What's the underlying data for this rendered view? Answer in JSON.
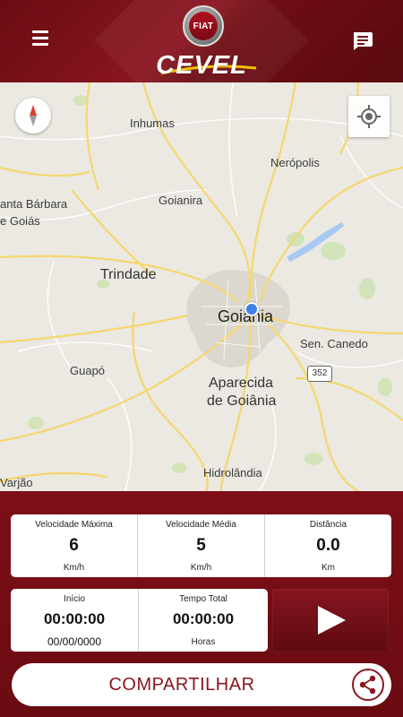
{
  "header": {
    "brand_badge": "FIAT",
    "dealer_name": "CEVEL",
    "menu_icon": "hamburger-menu-icon",
    "chat_icon": "chat-bubble-icon"
  },
  "map": {
    "labels": {
      "inhumas": "Inhumas",
      "neropolis": "Nerópolis",
      "santa_barbara_line1": "anta Bárbara",
      "santa_barbara_line2": "e Goiás",
      "goianira": "Goianira",
      "trindade": "Trindade",
      "goiania": "Goiânia",
      "sen_canedo": "Sen. Canedo",
      "guapo": "Guapó",
      "aparecida_line1": "Aparecida",
      "aparecida_line2": "de Goiânia",
      "hidrolandia": "Hidrolândia",
      "varjao": "Varjão",
      "highway": "352"
    },
    "compass_icon": "compass-icon",
    "locate_icon": "my-location-icon"
  },
  "stats": {
    "max_speed": {
      "label": "Velocidade Máxima",
      "value": "6",
      "unit": "Km/h"
    },
    "avg_speed": {
      "label": "Velocidade Média",
      "value": "5",
      "unit": "Km/h"
    },
    "distance": {
      "label": "Distância",
      "value": "0.0",
      "unit": "Km"
    },
    "start": {
      "label": "Início",
      "value": "00:00:00",
      "date": "00/00/0000"
    },
    "total_time": {
      "label": "Tempo Total",
      "value": "00:00:00",
      "unit": "Horas"
    }
  },
  "actions": {
    "play_icon": "play-icon",
    "share_label": "COMPARTILHAR",
    "share_icon": "share-icon"
  },
  "colors": {
    "brand_red": "#7a0f16",
    "share_text": "#8b1620",
    "road_yellow": "#f5d76e",
    "map_bg": "#ebe9e2",
    "location_dot": "#3f7fe8"
  }
}
